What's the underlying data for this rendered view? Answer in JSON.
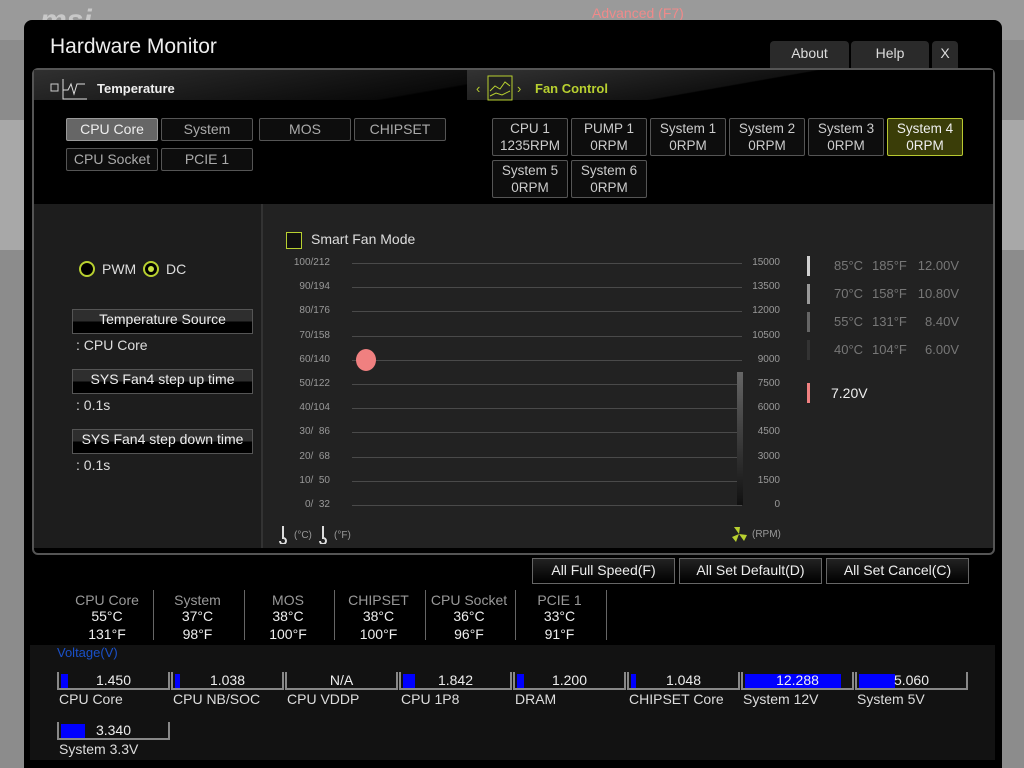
{
  "background": {
    "logo": "msi",
    "mode_label": "Advanced (F7)"
  },
  "window": {
    "title": "Hardware Monitor",
    "about": "About",
    "help": "Help",
    "close": "X"
  },
  "tabs": {
    "temperature": "Temperature",
    "fan_control": "Fan Control"
  },
  "temp_sources": [
    {
      "label": "CPU Core",
      "selected": true
    },
    {
      "label": "System"
    },
    {
      "label": "MOS"
    },
    {
      "label": "CHIPSET"
    },
    {
      "label": "CPU Socket"
    },
    {
      "label": "PCIE 1"
    }
  ],
  "fans": [
    {
      "name": "CPU 1",
      "rpm": "1235RPM"
    },
    {
      "name": "PUMP 1",
      "rpm": "0RPM"
    },
    {
      "name": "System 1",
      "rpm": "0RPM"
    },
    {
      "name": "System 2",
      "rpm": "0RPM"
    },
    {
      "name": "System 3",
      "rpm": "0RPM"
    },
    {
      "name": "System 4",
      "rpm": "0RPM",
      "selected": true
    },
    {
      "name": "System 5",
      "rpm": "0RPM"
    },
    {
      "name": "System 6",
      "rpm": "0RPM"
    }
  ],
  "fan_settings": {
    "pwm": "PWM",
    "dc": "DC",
    "mode_selected": "DC",
    "temp_source_btn": "Temperature Source",
    "temp_source_val": ": CPU Core",
    "step_up_btn": "SYS Fan4 step up time",
    "step_up_val": ": 0.1s",
    "step_down_btn": "SYS Fan4 step down time",
    "step_down_val": ": 0.1s"
  },
  "smart_fan_mode": {
    "label": "Smart Fan Mode",
    "checked": false
  },
  "chart": {
    "left_ticks": [
      "100/212",
      "90/194",
      "80/176",
      "70/158",
      "60/140",
      "50/122",
      "40/104",
      "30/  86",
      "20/  68",
      "10/  50",
      "0/  32"
    ],
    "right_ticks": [
      "15000",
      "13500",
      "12000",
      "10500",
      "9000",
      "7500",
      "6000",
      "4500",
      "3000",
      "1500",
      "0"
    ],
    "unit_c": "(°C)",
    "unit_f": "(°F)",
    "unit_rpm": "(RPM)",
    "current_temp_c": 55,
    "point_color": "#f08080",
    "rpm_slider_level": 0.55
  },
  "voltage_legend": [
    {
      "c": "85°C",
      "f": "185°F",
      "v": "12.00V",
      "color": "#d0d0d0"
    },
    {
      "c": "70°C",
      "f": "158°F",
      "v": "10.80V",
      "color": "#9a9a9a"
    },
    {
      "c": "55°C",
      "f": "131°F",
      "v": "8.40V",
      "color": "#666666"
    },
    {
      "c": "40°C",
      "f": "104°F",
      "v": "6.00V",
      "color": "#333333"
    }
  ],
  "current_voltage": {
    "v": "7.20V",
    "color": "#f08080"
  },
  "actions": {
    "full": "All Full Speed(F)",
    "default": "All Set Default(D)",
    "cancel": "All Set Cancel(C)"
  },
  "temps": [
    {
      "name": "CPU Core",
      "c": "55°C",
      "f": "131°F"
    },
    {
      "name": "System",
      "c": "37°C",
      "f": "98°F"
    },
    {
      "name": "MOS",
      "c": "38°C",
      "f": "100°F"
    },
    {
      "name": "CHIPSET",
      "c": "38°C",
      "f": "100°F"
    },
    {
      "name": "CPU Socket",
      "c": "36°C",
      "f": "96°F"
    },
    {
      "name": "PCIE 1",
      "c": "33°C",
      "f": "91°F"
    }
  ],
  "voltage": {
    "title": "Voltage(V)",
    "accent": "#1a50c8",
    "bar_color": "#0000ff",
    "items": [
      {
        "name": "CPU Core",
        "value": "1.450",
        "fill": 0.06
      },
      {
        "name": "CPU NB/SOC",
        "value": "1.038",
        "fill": 0.05
      },
      {
        "name": "CPU VDDP",
        "value": "N/A",
        "fill": 0
      },
      {
        "name": "CPU 1P8",
        "value": "1.842",
        "fill": 0.11
      },
      {
        "name": "DRAM",
        "value": "1.200",
        "fill": 0.06
      },
      {
        "name": "CHIPSET Core",
        "value": "1.048",
        "fill": 0.05
      },
      {
        "name": "System 12V",
        "value": "12.288",
        "fill": 0.88
      },
      {
        "name": "System 5V",
        "value": "5.060",
        "fill": 0.33
      },
      {
        "name": "System 3.3V",
        "value": "3.340",
        "fill": 0.22
      }
    ]
  }
}
